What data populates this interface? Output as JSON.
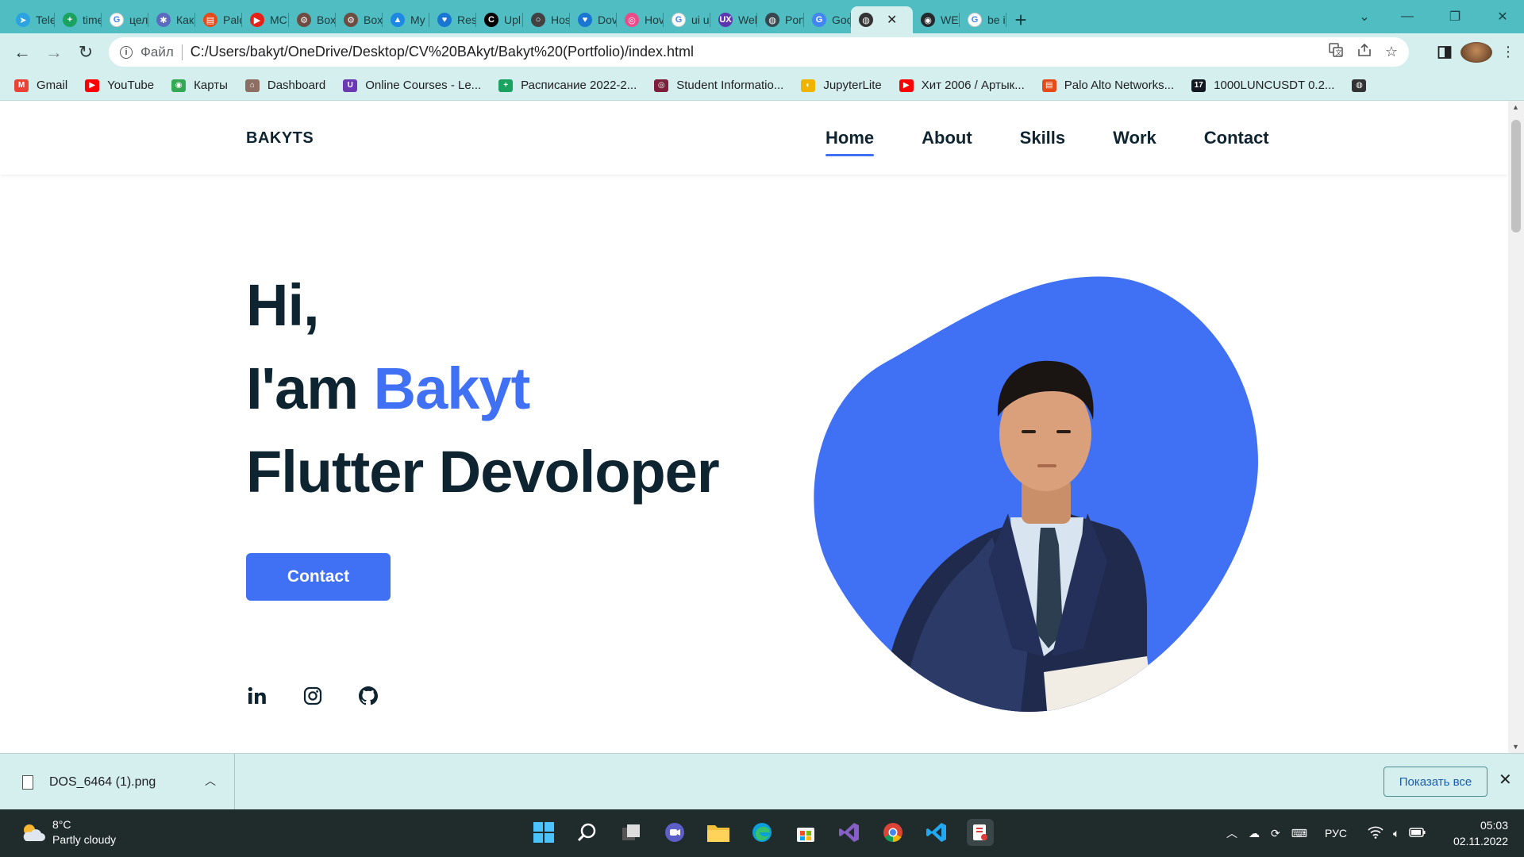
{
  "browser": {
    "tabs": [
      {
        "title": "Tele",
        "color": "#2aa3e0",
        "glyph": "➤"
      },
      {
        "title": "time",
        "color": "#1aa260",
        "glyph": "+"
      },
      {
        "title": "цел",
        "color": "#ffffff",
        "glyph": "G"
      },
      {
        "title": "Как",
        "color": "#5c6bc0",
        "glyph": "✱"
      },
      {
        "title": "Palo",
        "color": "#e64a19",
        "glyph": "▤"
      },
      {
        "title": "MC",
        "color": "#e62117",
        "glyph": "▶"
      },
      {
        "title": "Box",
        "color": "#6d4c41",
        "glyph": "⚙"
      },
      {
        "title": "Box",
        "color": "#6d4c41",
        "glyph": "⚙"
      },
      {
        "title": "My",
        "color": "#1e88e5",
        "glyph": "▲"
      },
      {
        "title": "Res",
        "color": "#1976d2",
        "glyph": "♥"
      },
      {
        "title": "Upl",
        "color": "#000000",
        "glyph": "C"
      },
      {
        "title": "Hos",
        "color": "#424242",
        "glyph": "○"
      },
      {
        "title": "Dov",
        "color": "#1976d2",
        "glyph": "♥"
      },
      {
        "title": "Hov",
        "color": "#ea4c89",
        "glyph": "◎"
      },
      {
        "title": "ui u",
        "color": "#ffffff",
        "glyph": "G"
      },
      {
        "title": "Wel",
        "color": "#5e35b1",
        "glyph": "UX"
      },
      {
        "title": "Port",
        "color": "#37474f",
        "glyph": "◍"
      },
      {
        "title": "Goo",
        "color": "#4285f4",
        "glyph": "G"
      }
    ],
    "active_tab": {
      "title": "",
      "close": "✕"
    },
    "tabs_after": [
      {
        "title": "WEI",
        "color": "#24292e",
        "glyph": "◉"
      },
      {
        "title": "be i",
        "color": "#ffffff",
        "glyph": "G"
      }
    ],
    "new_tab": "+",
    "window_controls": [
      "⌄",
      "—",
      "❐",
      "✕"
    ],
    "nav": {
      "back": "←",
      "forward": "→",
      "reload": "↻"
    },
    "address": {
      "scheme": "Файл",
      "url": "C:/Users/bakyt/OneDrive/Desktop/CV%20BAkyt/Bakyt%20(Portfolio)/index.html"
    },
    "bookmarks": [
      {
        "label": "Gmail",
        "color": "#ea4335",
        "glyph": "M"
      },
      {
        "label": "YouTube",
        "color": "#ff0000",
        "glyph": "▶"
      },
      {
        "label": "Карты",
        "color": "#34a853",
        "glyph": "◉"
      },
      {
        "label": "Dashboard",
        "color": "#8d6e63",
        "glyph": "⌂"
      },
      {
        "label": "Online Courses - Le...",
        "color": "#6a3ab2",
        "glyph": "U"
      },
      {
        "label": "Расписание 2022-2...",
        "color": "#1aa260",
        "glyph": "+"
      },
      {
        "label": "Student Informatio...",
        "color": "#7b1f3a",
        "glyph": "◎"
      },
      {
        "label": "JupyterLite",
        "color": "#f0b400",
        "glyph": "◐"
      },
      {
        "label": "Хит 2006 / Артык...",
        "color": "#ff0000",
        "glyph": "▶"
      },
      {
        "label": "Palo Alto Networks...",
        "color": "#e64a19",
        "glyph": "▤"
      },
      {
        "label": "1000LUNCUSDT 0.2...",
        "color": "#131722",
        "glyph": "17"
      },
      {
        "label": "",
        "color": "#333333",
        "glyph": "◍"
      }
    ]
  },
  "site": {
    "brand": "BAKYTS",
    "nav": [
      "Home",
      "About",
      "Skills",
      "Work",
      "Contact"
    ],
    "hero": {
      "line1": "Hi,",
      "line2_prefix": "I'am ",
      "name": "Bakyt",
      "line3": "Flutter Devoloper"
    },
    "cta_label": "Contact",
    "accent_color": "#4070f4",
    "text_color": "#0e2431",
    "social": [
      "linkedin-icon",
      "instagram-icon",
      "github-icon"
    ]
  },
  "downloads": {
    "file": "DOS_6464 (1).png",
    "show_all": "Показать все",
    "close": "✕"
  },
  "taskbar": {
    "weather_temp": "8°C",
    "weather_desc": "Partly cloudy",
    "lang": "РУС",
    "time": "05:03",
    "date": "02.11.2022"
  }
}
